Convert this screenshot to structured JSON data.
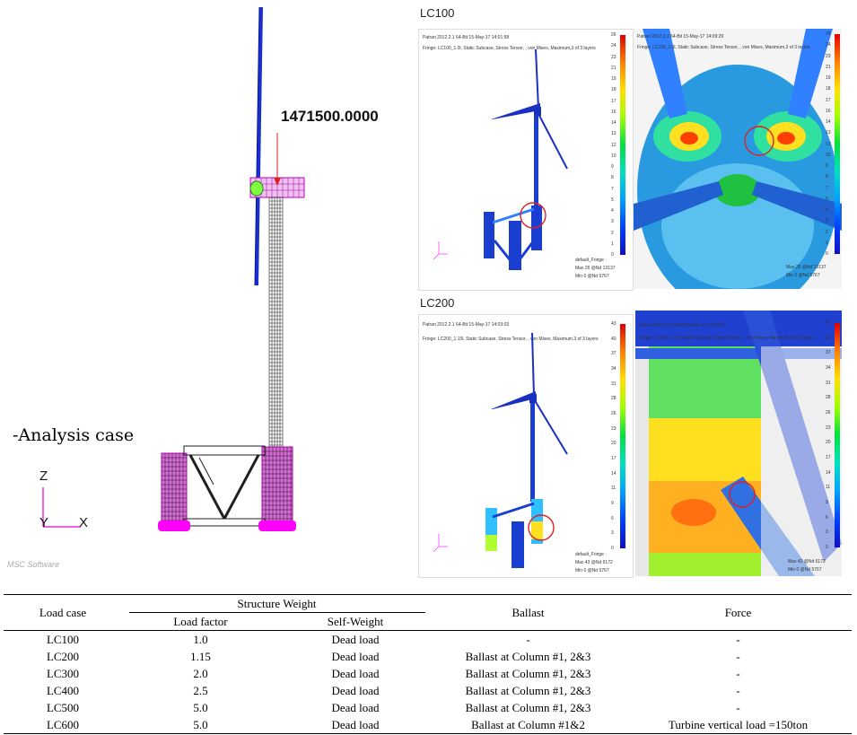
{
  "left_view": {
    "force_value": "1471500.0000",
    "analysis_label": "-Analysis case",
    "axis": {
      "z": "Z",
      "y": "Y",
      "x": "X"
    },
    "logo_text": "MSC Software"
  },
  "lc100": {
    "label": "LC100",
    "header_line1": "Patran 2012.2.1 64-Bit 15-May-17 14:01:58",
    "header_line2": "Fringe: LC100_1.0l, Static Subcase, Stress Tensor, , von Mises, Maximum,3 of 3 layers",
    "zoom_header_line1": "Patran 2012.2.1 64-Bit 15-May-17 14:09:29",
    "zoom_header_line2": "Fringe: LC100_1.0l, Static Subcase, Stress Tensor, , von Mises, Maximum,3 of 3 layers",
    "fringe_title": "default_Fringe :",
    "fringe_max": "Max 26 @Nd 13137",
    "fringe_min": "Min 0 @Nd 5767",
    "zoom_fringe_max": "Max 26 @Nd 13137",
    "zoom_fringe_min": "Min 0 @Nd 5767",
    "scale": [
      "26",
      "24",
      "23",
      "21",
      "19",
      "18",
      "17",
      "16",
      "14",
      "13",
      "12",
      "10",
      "9",
      "8",
      "7",
      "5",
      "4",
      "3",
      "2",
      "1",
      "0"
    ]
  },
  "lc200": {
    "label": "LC200",
    "header_line1": "Patran 2012.2.1 64-Bit 15-May-17 14:03:03",
    "header_line2": "Fringe: LC200_1.15l, Static Subcase, Stress Tensor, , von Mises, Maximum,3 of 3 layers",
    "zoom_header_line1": "Patran 2012.2.1 64-Bit 15-May-17 14:07:37",
    "zoom_header_line2": "Fringe: LC200_1.15l, Static Subcase, Stress Tensor, , von Mises, Maximum,3 of 3 layers",
    "fringe_title": "default_Fringe :",
    "fringe_max": "Max 43 @Nd 6172",
    "fringe_min": "Min 0 @Nd 5767",
    "zoom_fringe_max": "Max 43 @Nd 6172",
    "zoom_fringe_min": "Min 0 @Nd 5767",
    "scale": [
      "43",
      "40",
      "37",
      "34",
      "31",
      "28",
      "26",
      "23",
      "20",
      "17",
      "14",
      "11",
      "9",
      "6",
      "3",
      "0"
    ]
  },
  "table": {
    "headers": {
      "load_case": "Load case",
      "structure_weight": "Structure Weight",
      "load_factor": "Load factor",
      "self_weight": "Self-Weight",
      "ballast": "Ballast",
      "force": "Force"
    },
    "rows": [
      {
        "load_case": "LC100",
        "load_factor": "1.0",
        "self_weight": "Dead load",
        "ballast": "-",
        "force": "-"
      },
      {
        "load_case": "LC200",
        "load_factor": "1.15",
        "self_weight": "Dead load",
        "ballast": "Ballast at Column #1, 2&3",
        "force": "-"
      },
      {
        "load_case": "LC300",
        "load_factor": "2.0",
        "self_weight": "Dead load",
        "ballast": "Ballast at Column #1, 2&3",
        "force": "-"
      },
      {
        "load_case": "LC400",
        "load_factor": "2.5",
        "self_weight": "Dead load",
        "ballast": "Ballast at Column #1, 2&3",
        "force": "-"
      },
      {
        "load_case": "LC500",
        "load_factor": "5.0",
        "self_weight": "Dead load",
        "ballast": "Ballast at Column #1, 2&3",
        "force": "-"
      },
      {
        "load_case": "LC600",
        "load_factor": "5.0",
        "self_weight": "Dead load",
        "ballast": "Ballast at Column #1&2",
        "force": "Turbine vertical load =150ton"
      }
    ]
  },
  "colors": {
    "magenta": "#e000e0",
    "blue": "#1a2fd0",
    "red": "#e02020",
    "mesh": "#202020"
  }
}
